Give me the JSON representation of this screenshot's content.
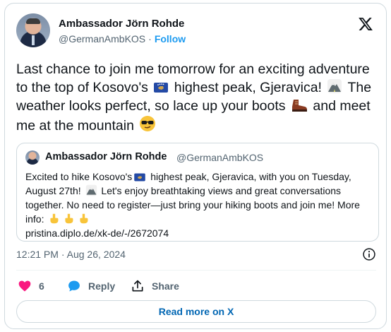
{
  "author": {
    "name": "Ambassador Jörn Rohde",
    "handle": "@GermanAmbKOS",
    "separator": "·",
    "follow_label": "Follow"
  },
  "tweet": {
    "text_parts": [
      "Last chance to join me tomorrow for an exciting adventure to the top of Kosovo's ",
      " highest peak, Gjeravica! ",
      " The weather looks perfect, so lace up your boots ",
      " and meet me at the mountain "
    ]
  },
  "quoted": {
    "name": "Ambassador Jörn Rohde",
    "handle": "@GermanAmbKOS",
    "text_parts": [
      "Excited to hike Kosovo's",
      " highest peak, Gjeravica, with you on Tuesday, August 27th! ",
      " Let's enjoy breathtaking views and great conversations together. No need to register—just bring your hiking boots and join me! More info: ",
      "pristina.diplo.de/xk-de/-/2672074"
    ]
  },
  "meta": {
    "time": "12:21 PM",
    "separator": "·",
    "date": "Aug 26, 2024"
  },
  "actions": {
    "like_count": "6",
    "reply_label": "Reply",
    "share_label": "Share"
  },
  "read_more_label": "Read more on X",
  "icons": {
    "like": "heart-icon",
    "reply": "speech-bubble-icon",
    "share": "share-icon",
    "info": "info-icon",
    "logo": "x-logo-icon",
    "flag": "kosovo-flag-icon",
    "mountain": "mountain-icon",
    "boot": "hiking-boot-icon",
    "sunglasses": "sunglasses-face-icon",
    "pointing": "pointing-down-icon"
  },
  "colors": {
    "link": "#1d9bf0",
    "read_more": "#0066b3",
    "like": "#f91880",
    "reply": "#1d9bf0",
    "muted": "#536471",
    "border": "#cfd9de"
  }
}
